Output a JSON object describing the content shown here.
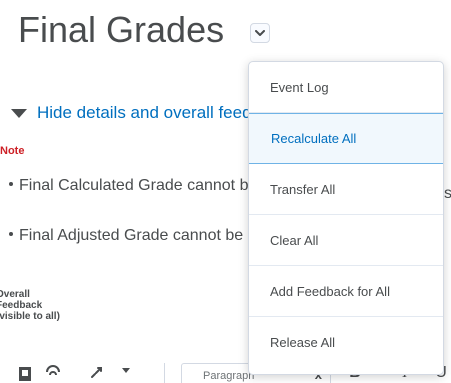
{
  "page": {
    "title": "Final Grades"
  },
  "details": {
    "toggle_label": "Hide details and overall feedback"
  },
  "note": {
    "label": "Note"
  },
  "notes": [
    "Final Calculated Grade cannot be changed",
    "Final Adjusted Grade cannot be changed"
  ],
  "stray_text": "s",
  "overall_feedback": {
    "line1": "Overall",
    "line2": "Feedback",
    "line3": "(visible to all)"
  },
  "toolbar": {
    "format_select_value": "Paragraph",
    "clear_glyph": "x",
    "bold_label": "B",
    "italic_label": "I",
    "underline_label": "U"
  },
  "menu": {
    "items": [
      {
        "label": "Event Log"
      },
      {
        "label": "Recalculate All",
        "state": "hovered"
      },
      {
        "label": "Transfer All"
      },
      {
        "label": "Clear All"
      },
      {
        "label": "Add Feedback for All"
      },
      {
        "label": "Release All"
      }
    ]
  },
  "colors": {
    "link": "#006fbf",
    "note_red": "#cd2026",
    "text": "#494c4e",
    "hover_bg": "#f1f8fd",
    "hover_border": "#6fb3e6"
  },
  "icons": {
    "title_menu": "chevron-down-icon",
    "toggle": "triangle-down-icon",
    "insert_stuff": "insert-stuff-icon",
    "insert_quicklink": "quicklink-icon",
    "insert_link": "link-icon",
    "more": "caret-down-icon"
  }
}
